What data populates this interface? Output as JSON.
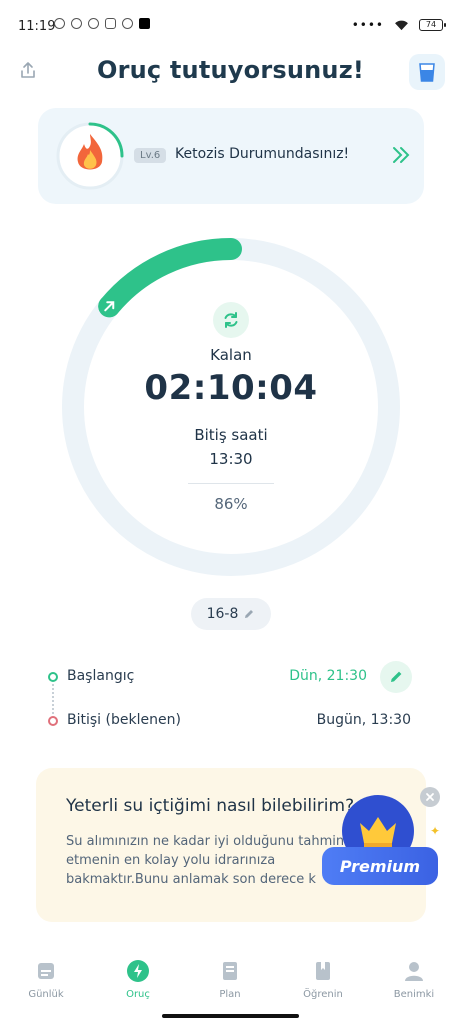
{
  "status_bar": {
    "time": "11:19",
    "battery": "74"
  },
  "header": {
    "title": "Oruç tutuyorsunuz!",
    "share_icon": "share-icon",
    "water_icon": "water-glass-icon"
  },
  "ketosis_card": {
    "level": "Lv.6",
    "text": "Ketozis Durumundasınız!",
    "icon": "flame-icon",
    "accent": "#2ec28a"
  },
  "timer": {
    "remaining_label": "Kalan",
    "remaining": "02:10:04",
    "end_label": "Bitiş saati",
    "end_time": "13:30",
    "percent_text": "86%",
    "progress": 0.14,
    "ring_color": "#2ec28a",
    "track_color": "#ecf3f8"
  },
  "plan": {
    "label": "16-8"
  },
  "timeline": {
    "start_label": "Başlangıç",
    "start_value": "Dün, 21:30",
    "end_label": "Bitişi (beklenen)",
    "end_value": "Bugün, 13:30"
  },
  "info_card": {
    "title": "Yeterli su içtiğimi nasıl bilebilirim?",
    "body": "Su alımınızın ne kadar iyi olduğunu tahmin etmenin en kolay yolu idrarınıza bakmaktır.Bunu anlamak son derece k",
    "premium_label": "Premium"
  },
  "bottom_nav": {
    "items": [
      {
        "label": "Günlük",
        "icon": "journal-icon"
      },
      {
        "label": "Oruç",
        "icon": "lightning-icon"
      },
      {
        "label": "Plan",
        "icon": "plan-icon"
      },
      {
        "label": "Öğrenin",
        "icon": "book-icon"
      },
      {
        "label": "Benimki",
        "icon": "profile-icon"
      }
    ],
    "active": "Oruç"
  }
}
